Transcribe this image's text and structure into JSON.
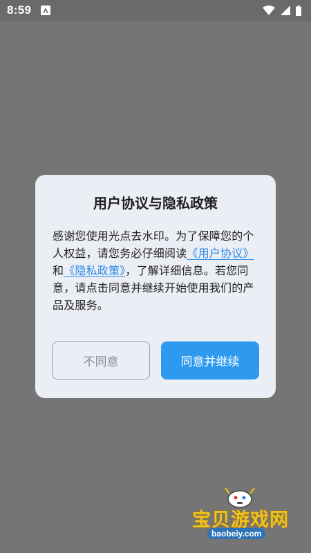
{
  "status_bar": {
    "time": "8:59",
    "icons": [
      "app-notification-icon",
      "wifi-icon",
      "signal-icon",
      "battery-icon"
    ]
  },
  "dialog": {
    "title": "用户协议与隐私政策",
    "body": {
      "part1": "感谢您使用光点去水印。为了保障您的个人权益，请您务必仔细阅读",
      "link_user_agreement": "《用户协议》",
      "and": "和",
      "link_privacy_policy": "《隐私政策》",
      "part2": "，了解详细信息。若您同意，请点击同意并继续开始使用我们的产品及服务。"
    },
    "buttons": {
      "disagree": "不同意",
      "agree": "同意并继续"
    }
  },
  "watermark": {
    "text": "宝贝游戏网",
    "url": "baobeiy.com"
  },
  "colors": {
    "overlay": "#757575",
    "dialog_bg": "#eceef5",
    "link": "#2b8be8",
    "primary_button": "#2d9af0",
    "watermark_text": "#f1c21b"
  }
}
